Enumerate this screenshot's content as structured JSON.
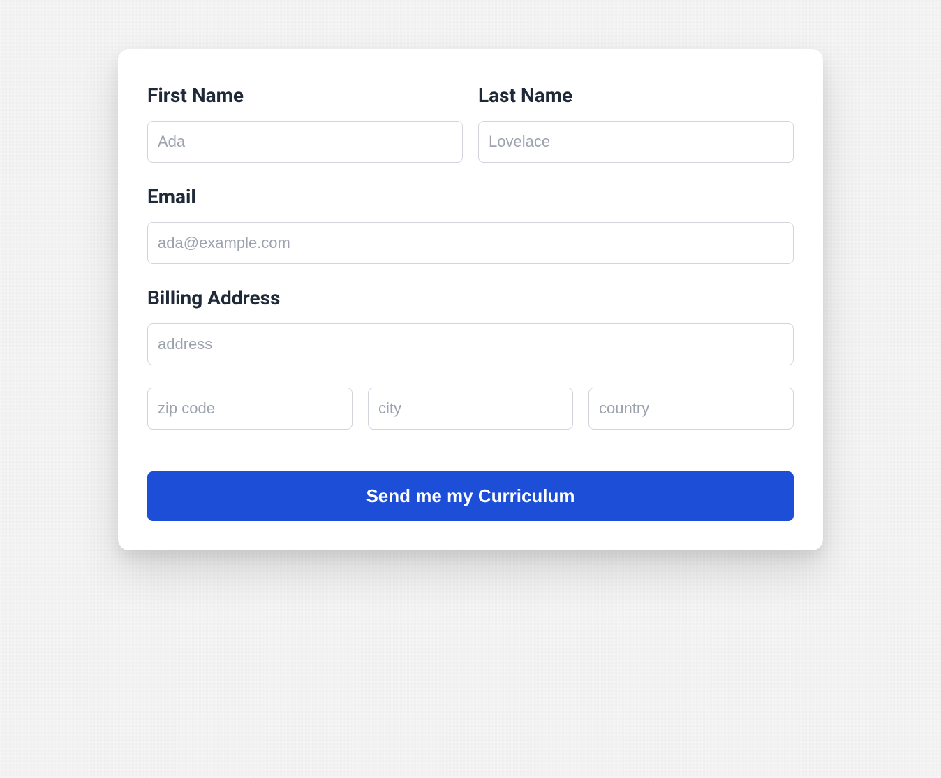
{
  "form": {
    "first_name": {
      "label": "First Name",
      "placeholder": "Ada",
      "value": ""
    },
    "last_name": {
      "label": "Last Name",
      "placeholder": "Lovelace",
      "value": ""
    },
    "email": {
      "label": "Email",
      "placeholder": "ada@example.com",
      "value": ""
    },
    "billing_address": {
      "label": "Billing Address",
      "address_placeholder": "address",
      "zip_placeholder": "zip code",
      "city_placeholder": "city",
      "country_placeholder": "country"
    },
    "submit_label": "Send me my Curriculum"
  }
}
